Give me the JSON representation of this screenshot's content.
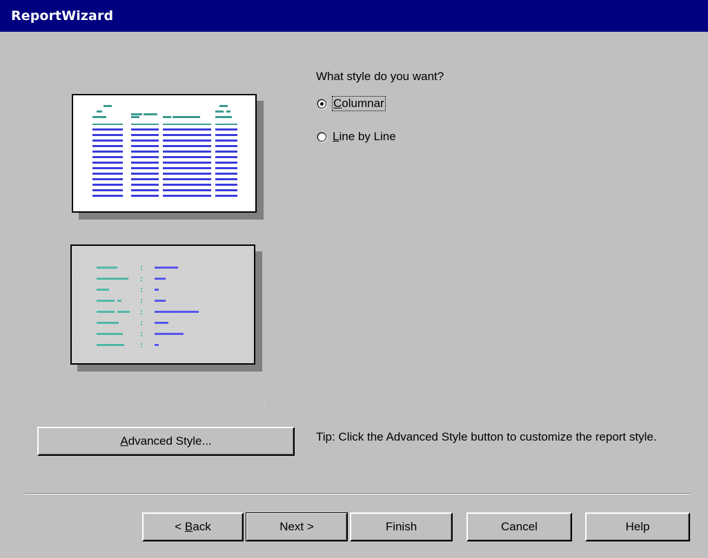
{
  "window": {
    "title": "ReportWizard"
  },
  "style_question": "What style do you want?",
  "options": [
    {
      "label": "Columnar",
      "underline": "C",
      "rest": "olumnar",
      "selected": true
    },
    {
      "label": "Line by Line",
      "underline": "L",
      "rest": "ine by Line",
      "selected": false
    }
  ],
  "advanced_button": {
    "label": "Advanced Style...",
    "underline": "A",
    "rest": "dvanced Style..."
  },
  "tip": "Tip:  Click the Advanced Style button to customize the report style.",
  "buttons": {
    "back": {
      "prefix": "< ",
      "underline": "B",
      "rest": "ack"
    },
    "next": "Next >",
    "finish": "Finish",
    "cancel": "Cancel",
    "help": "Help"
  },
  "colors": {
    "title_bar": "#000080",
    "dialog_face": "#c0c0c0",
    "preview_header": "#3a9a8e",
    "preview_data": "#3b3bdc",
    "line_label": "#4fb8a8",
    "line_value": "#5555ee"
  }
}
